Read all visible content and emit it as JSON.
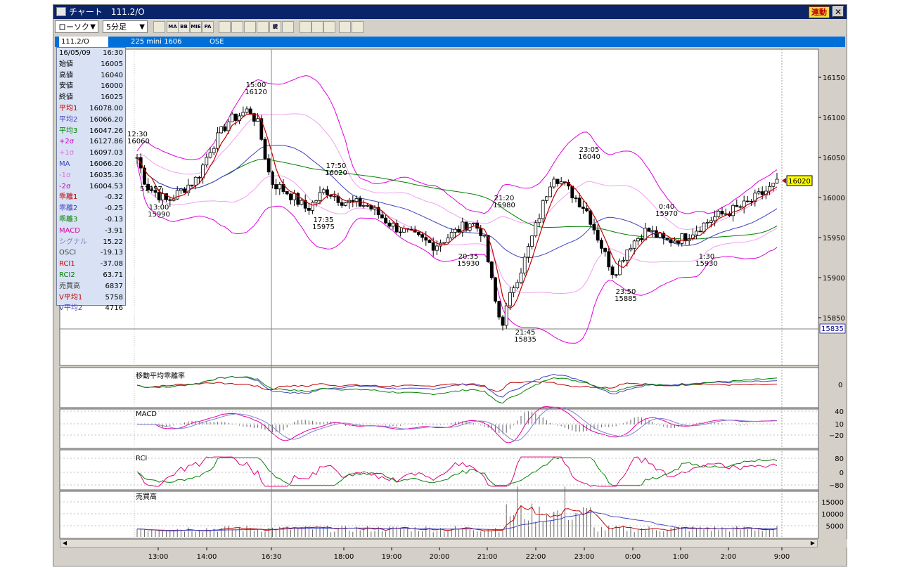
{
  "window": {
    "title": "チャート　111.2/O",
    "renkan_label": "連動",
    "close_label": "✕"
  },
  "toolbar": {
    "chart_type": "ローソク",
    "interval": "5分足",
    "buttons": [
      {
        "name": "candle-type-icon",
        "label": ""
      },
      {
        "name": "ma-button",
        "label": "MA"
      },
      {
        "name": "bb-button",
        "label": "BB"
      },
      {
        "name": "mie-button",
        "label": "MIE"
      },
      {
        "name": "pa-button",
        "label": "PA"
      },
      {
        "name": "line-chart-icon",
        "label": ""
      },
      {
        "name": "point-figure-icon",
        "label": ""
      },
      {
        "name": "tools-icon",
        "label": ""
      },
      {
        "name": "zoom-icon",
        "label": ""
      },
      {
        "name": "kagi-icon",
        "label": "鍵"
      },
      {
        "name": "grid-icon",
        "label": ""
      },
      {
        "name": "pencil-icon",
        "label": ""
      },
      {
        "name": "cursor-icon",
        "label": ""
      },
      {
        "name": "hand-icon",
        "label": ""
      },
      {
        "name": "settings-icon",
        "label": ""
      },
      {
        "name": "crossline-icon",
        "label": ""
      }
    ]
  },
  "infobar": {
    "symbol": "111.2/O",
    "name": "225 mini 1606",
    "exchange": "OSE"
  },
  "data_panel": [
    {
      "k": "16/05/09",
      "v": "16:30",
      "c": "#000000"
    },
    {
      "k": "始値",
      "v": "16005",
      "c": "#000000"
    },
    {
      "k": "高値",
      "v": "16040",
      "c": "#000000"
    },
    {
      "k": "安値",
      "v": "16000",
      "c": "#000000"
    },
    {
      "k": "終値",
      "v": "16025",
      "c": "#000000"
    },
    {
      "k": "平均1",
      "v": "16078.00",
      "c": "#c00000"
    },
    {
      "k": "平均2",
      "v": "16066.20",
      "c": "#4040c0"
    },
    {
      "k": "平均3",
      "v": "16047.26",
      "c": "#008000"
    },
    {
      "k": "+2σ",
      "v": "16127.86",
      "c": "#c000c0"
    },
    {
      "k": "+1σ",
      "v": "16097.03",
      "c": "#e070e0"
    },
    {
      "k": "MA",
      "v": "16066.20",
      "c": "#4040c0"
    },
    {
      "k": "-1σ",
      "v": "16035.36",
      "c": "#e070e0"
    },
    {
      "k": "-2σ",
      "v": "16004.53",
      "c": "#c000c0"
    },
    {
      "k": "乖離1",
      "v": "-0.32",
      "c": "#c00000"
    },
    {
      "k": "乖離2",
      "v": "-0.25",
      "c": "#4040c0"
    },
    {
      "k": "乖離3",
      "v": "-0.13",
      "c": "#008000"
    },
    {
      "k": "MACD",
      "v": "-3.91",
      "c": "#e000a0"
    },
    {
      "k": "シグナル",
      "v": "15.22",
      "c": "#8080c0"
    },
    {
      "k": "OSCI",
      "v": "-19.13",
      "c": "#404040"
    },
    {
      "k": "RCI1",
      "v": "-37.08",
      "c": "#c00000"
    },
    {
      "k": "RCI2",
      "v": "63.71",
      "c": "#008000"
    },
    {
      "k": "売買高",
      "v": "6837",
      "c": "#404040"
    },
    {
      "k": "V平均1",
      "v": "5758",
      "c": "#c00000"
    },
    {
      "k": "V平均2",
      "v": "4716",
      "c": "#4040c0"
    }
  ],
  "panes": {
    "deviation": "移動平均乖離率",
    "macd": "MACD",
    "rci": "RCI",
    "volume": "売買高"
  },
  "scales": {
    "price": [
      "16150",
      "16100",
      "16050",
      "16000",
      "15950",
      "15900",
      "15850"
    ],
    "deviation": [
      "0"
    ],
    "macd": [
      "40",
      "10",
      "−20"
    ],
    "rci": [
      "80",
      "0",
      "−80"
    ],
    "volume": [
      "15000",
      "10000",
      "5000"
    ]
  },
  "last_price": "16020",
  "cursor_price": "15835",
  "time_axis": [
    "13:00",
    "14:00",
    "16:30",
    "18:00",
    "19:00",
    "20:00",
    "21:00",
    "22:00",
    "23:00",
    "0:00",
    "1:00",
    "2:00",
    "9:00"
  ],
  "annotations": [
    {
      "t": "12:30",
      "p": "16060"
    },
    {
      "t": "13:00",
      "p": "15990"
    },
    {
      "t": "15:00",
      "p": "16120"
    },
    {
      "t": "17:50",
      "p": "16020"
    },
    {
      "t": "17:35",
      "p": "15975"
    },
    {
      "t": "20:35",
      "p": "15930"
    },
    {
      "t": "21:20",
      "p": "15980"
    },
    {
      "t": "21:45",
      "p": "15835"
    },
    {
      "t": "23:05",
      "p": "16040"
    },
    {
      "t": "23:50",
      "p": "15885"
    },
    {
      "t": "0:40",
      "p": "15970"
    },
    {
      "t": "1:30",
      "p": "15930"
    }
  ],
  "mini_label": "51957",
  "colors": {
    "ma1": "#c00000",
    "ma2": "#4040c0",
    "ma3": "#008000",
    "bb2": "#e000e0",
    "bb1": "#f0a0f0",
    "macd": "#e000a0",
    "signal": "#8080d0"
  }
}
